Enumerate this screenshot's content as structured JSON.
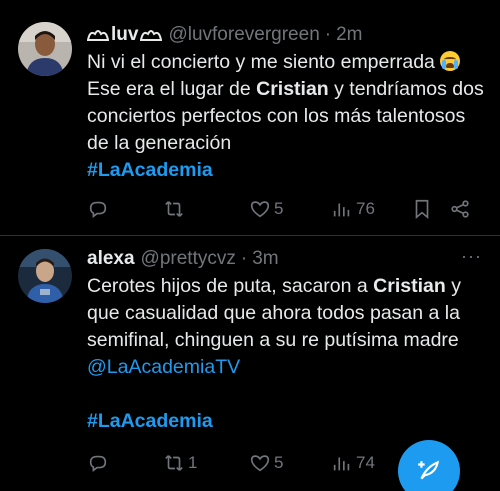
{
  "tweets": [
    {
      "name": "luv",
      "handle": "@luvforevergreen",
      "time": "2m",
      "text_parts": {
        "p1": "Ni vi el concierto y me siento emperrada ",
        "p2": " Ese era el lugar de ",
        "bold1": "Cristian",
        "p3": " y tendríamos dos conciertos perfectos con los más talentosos de la generación",
        "hashtag": "#LaAcademia"
      },
      "actions": {
        "replies": "",
        "retweets": "",
        "likes": "5",
        "views": "76"
      }
    },
    {
      "name": "alexa",
      "handle": "@prettycvz",
      "time": "3m",
      "text_parts": {
        "p1": "Cerotes hijos de puta, sacaron a ",
        "bold1": "Cristian",
        "p2": " y que casualidad que ahora todos pasan a la semifinal, chinguen a su re putísima madre ",
        "mention": "@LaAcademiaTV",
        "hashtag": "#LaAcademia"
      },
      "actions": {
        "replies": "",
        "retweets": "1",
        "likes": "5",
        "views": "74"
      }
    }
  ],
  "ui": {
    "dot": "·",
    "more": "···"
  },
  "icons": {
    "reply": "reply-icon",
    "retweet": "retweet-icon",
    "like": "heart-icon",
    "views": "views-icon",
    "bookmark": "bookmark-icon",
    "share": "share-icon",
    "compose": "compose-icon",
    "name_deco": "crown-icon",
    "emoji": "crying-face-emoji"
  },
  "colors": {
    "accent": "#1d9bf0",
    "muted": "#71767b",
    "text": "#e7e9ea",
    "divider": "#2f3336"
  }
}
